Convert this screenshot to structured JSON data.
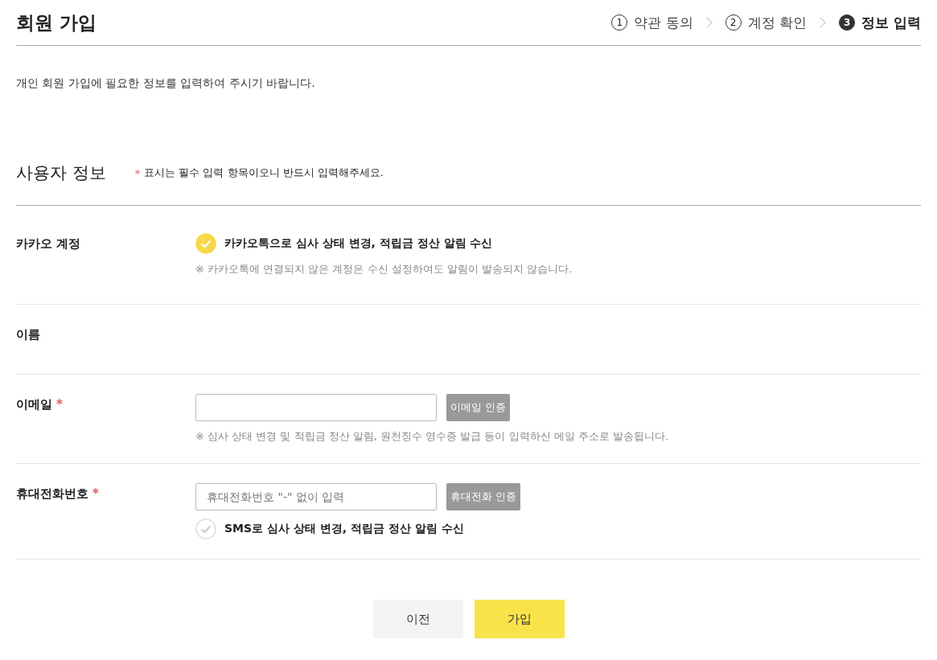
{
  "page_title": "회원 가입",
  "steps": [
    {
      "number": "1",
      "label": "약관 동의",
      "selected": false
    },
    {
      "number": "2",
      "label": "계정 확인",
      "selected": false
    },
    {
      "number": "3",
      "label": "정보 입력",
      "selected": true
    }
  ],
  "intro": "개인 회원 가입에 필요한 정보를 입력하여 주시기 바랍니다.",
  "section": {
    "title": "사용자 정보",
    "notice_mark": "*",
    "notice": "표시는 필수 입력 항목이오니 반드시 입력해주세요."
  },
  "rows": [
    {
      "label": "카카오 계정",
      "checkbox": {
        "checked": true,
        "label": "카카오톡으로 심사 상태 변경, 적립금 정산 알림 수신"
      },
      "note": "※ 카카오톡에 연결되지 않은 계정은 수신 설정하여도 알림이 발송되지 않습니다."
    },
    {
      "label": "이름"
    },
    {
      "label": "이메일",
      "required_mark": "*",
      "input": {
        "button": "이메일 인증"
      },
      "note": "※ 심사 상태 변경 및 적립금 정산 알림, 원천징수 영수증 발급 등이 입력하신 메일 주소로 발송됩니다."
    },
    {
      "label": "휴대전화번호",
      "required_mark": "*",
      "input": {
        "placeholder": "휴대전화번호 \"-\" 없이 입력",
        "button": "휴대전화 인증"
      },
      "checkbox": {
        "checked": false,
        "label": "SMS로 심사 상태 변경, 적립금 정산 알림 수신"
      }
    }
  ],
  "buttons": [
    {
      "label": "이전",
      "kind": "secondary"
    },
    {
      "label": "가입",
      "kind": "primary"
    }
  ]
}
